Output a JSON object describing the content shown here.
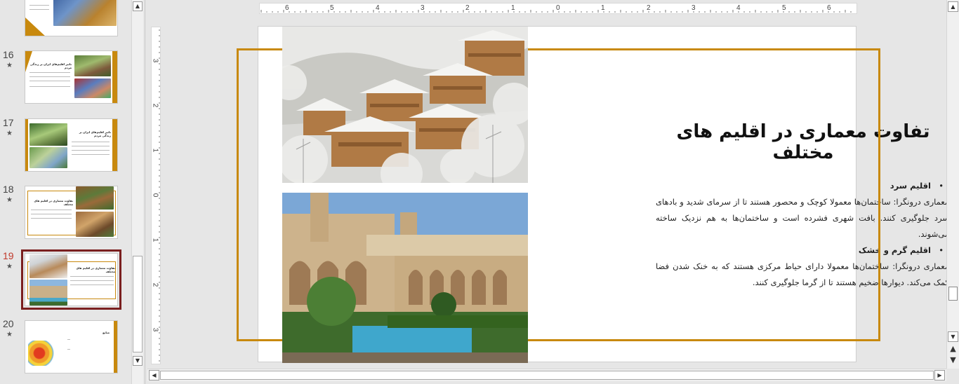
{
  "thumbnails": [
    {
      "number": "16",
      "title": "تاثیر اقلیم‌های ایران بر زندگی مردم"
    },
    {
      "number": "17",
      "title": "تاثیر اقلیم‌های ایران بر زندگی مردم"
    },
    {
      "number": "18",
      "title": "تفاوت معماری در اقلیم های مختلف"
    },
    {
      "number": "19",
      "title": "تفاوت معماری در اقلیم های مختلف"
    },
    {
      "number": "20",
      "title": "منابع"
    }
  ],
  "star_icon": "★",
  "ruler": {
    "horizontal": [
      "6",
      "5",
      "4",
      "3",
      "2",
      "1",
      "0",
      "1",
      "2",
      "3",
      "4",
      "5",
      "6"
    ],
    "vertical": [
      "3",
      "2",
      "1",
      "0",
      "1",
      "2",
      "3"
    ]
  },
  "slide": {
    "title": "تفاوت معماری در اقلیم های مختلف",
    "bullet1_heading": "اقلیم سرد",
    "bullet1_text": "معماری درونگرا: ساختمان‌ها معمولا کوچک و محصور هستند تا از سرمای شدید و بادهای سرد جلوگیری کنند. بافت شهری فشرده است و ساختمان‌ها به هم نزدیک ساخته می‌شوند.",
    "bullet2_heading": "اقلیم گرم و خشک",
    "bullet2_text": "معماری درونگرا: ساختمان‌ها معمولا دارای حیاط مرکزی هستند که به خنک شدن فضا کمک می‌کند. دیوارها ضخیم هستند تا از گرما جلوگیری کنند."
  },
  "colors": {
    "accent": "#c8890e",
    "selected_outline": "#7a1f1f",
    "active_number": "#c0392b"
  },
  "icons": {
    "up": "▲",
    "down": "▼",
    "left": "◀",
    "right": "▶",
    "prev_slide": "⯭",
    "next_slide": "⯯"
  }
}
